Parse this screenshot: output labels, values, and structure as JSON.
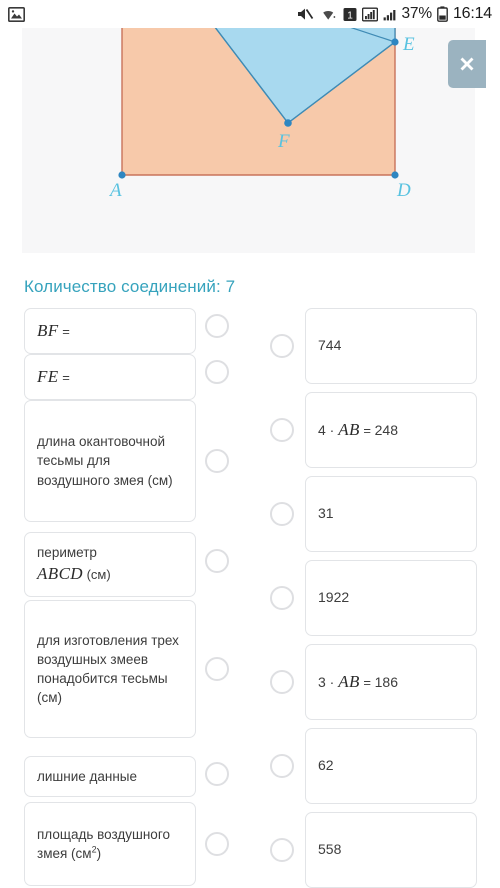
{
  "status_bar": {
    "left_icons": [
      "image-icon"
    ],
    "right_icons": [
      "mute-icon",
      "wifi-icon",
      "sim-1-icon",
      "signal-bars-icon",
      "signal-bars-2-icon"
    ],
    "battery_percent": "37%",
    "time": "16:14"
  },
  "figure": {
    "close_label": "×",
    "labels": {
      "a": "A",
      "d": "D",
      "e": "E",
      "f": "F"
    },
    "colors": {
      "rect_fill": "#f7c9aa",
      "rect_stroke": "#c9735a",
      "kite_fill": "#a8d9ef",
      "kite_stroke": "#3f8bb5",
      "point": "#2e86c1",
      "label": "#58c2e0",
      "panel_bg": "#f7f7f8"
    }
  },
  "connections": {
    "label": "Количество соединений: 7",
    "accent": "#36a3bd"
  },
  "left_items": [
    {
      "id": "bf",
      "kind": "math",
      "math": "BF",
      "eq": "="
    },
    {
      "id": "fe",
      "kind": "math",
      "math": "FE",
      "eq": "="
    },
    {
      "id": "tesma",
      "kind": "text",
      "text": "длина окантовочной тесьмы для воздушного змея (см)"
    },
    {
      "id": "perimeter",
      "kind": "mixed",
      "text": "периметр",
      "math": "ABCD",
      "unit": "(см)"
    },
    {
      "id": "three",
      "kind": "text",
      "text": "для изготовления трех воздушных змеев понадобится тесьмы (см)"
    },
    {
      "id": "extra",
      "kind": "text",
      "text": "лишние данные"
    },
    {
      "id": "area",
      "kind": "area",
      "text": "площадь воздушного змея",
      "unit_base": "(см",
      "unit_sup": "2",
      "unit_tail": ")"
    }
  ],
  "right_items": [
    {
      "id": "r744",
      "kind": "num",
      "value": "744"
    },
    {
      "id": "r4ab",
      "kind": "mixed",
      "coef": "4 ·",
      "math": "AB",
      "eq": "=",
      "value": "248"
    },
    {
      "id": "r31",
      "kind": "num",
      "value": "31"
    },
    {
      "id": "r1922",
      "kind": "num",
      "value": "1922"
    },
    {
      "id": "r3ab",
      "kind": "mixed",
      "coef": "3 ·",
      "math": "AB",
      "eq": "=",
      "value": "186"
    },
    {
      "id": "r62",
      "kind": "num",
      "value": "62"
    },
    {
      "id": "r558",
      "kind": "num",
      "value": "558"
    }
  ]
}
